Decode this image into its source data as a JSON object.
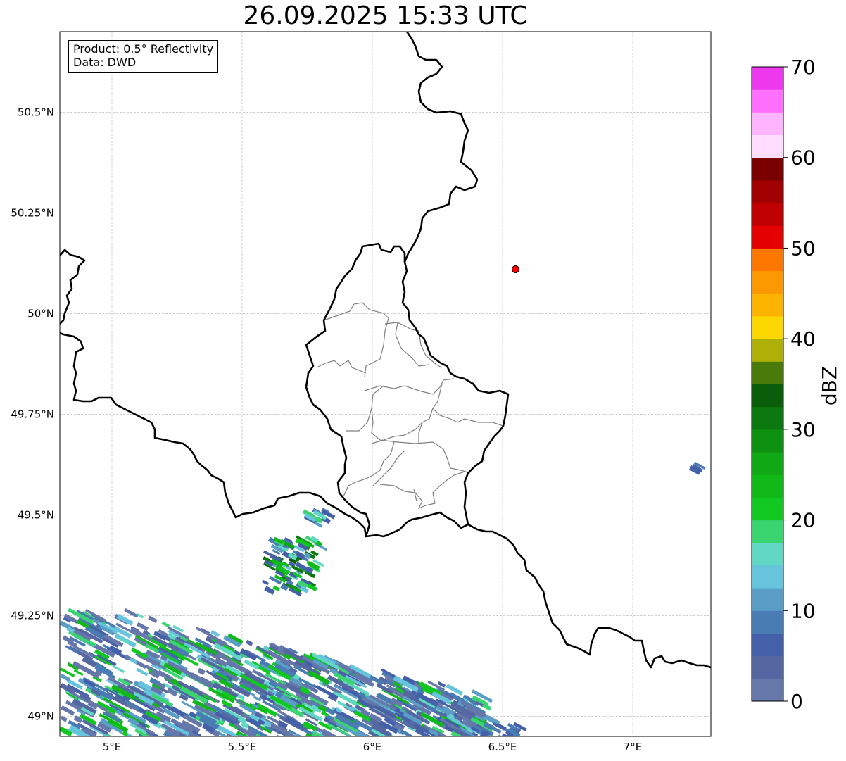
{
  "title": "26.09.2025 15:33 UTC",
  "info": {
    "product": "Product: 0.5° Reflectivity",
    "data": "Data: DWD"
  },
  "map": {
    "extent": {
      "lon_min": 4.8,
      "lon_max": 7.3,
      "lat_min": 48.95,
      "lat_max": 50.7
    },
    "lon_ticks": [
      {
        "value": 5.0,
        "label": "5°E"
      },
      {
        "value": 5.5,
        "label": "5.5°E"
      },
      {
        "value": 6.0,
        "label": "6°E"
      },
      {
        "value": 6.5,
        "label": "6.5°E"
      },
      {
        "value": 7.0,
        "label": "7°E"
      }
    ],
    "lat_ticks": [
      {
        "value": 50.5,
        "label": "50.5°N"
      },
      {
        "value": 50.25,
        "label": "50.25°N"
      },
      {
        "value": 50.0,
        "label": "50°N"
      },
      {
        "value": 49.75,
        "label": "49.75°N"
      },
      {
        "value": 49.5,
        "label": "49.5°N"
      },
      {
        "value": 49.25,
        "label": "49.25°N"
      },
      {
        "value": 49.0,
        "label": "49°N"
      }
    ],
    "radar_site": {
      "lon": 6.55,
      "lat": 50.11,
      "color": "#ff0000"
    },
    "colors": {
      "border": "#000000",
      "admin": "#808080",
      "grid": "#b0b0b0"
    }
  },
  "colorbar": {
    "label": "dBZ",
    "min": 0,
    "max": 70,
    "ticks": [
      "0",
      "10",
      "20",
      "30",
      "40",
      "50",
      "60",
      "70"
    ],
    "colors": [
      "#6677aa",
      "#5566a0",
      "#4460a8",
      "#4a7cb4",
      "#5a9ec8",
      "#66c4dc",
      "#60d8c4",
      "#3ad470",
      "#10c820",
      "#10b818",
      "#10a814",
      "#0e9010",
      "#0c7810",
      "#0a5e0a",
      "#4a7a0a",
      "#aeb008",
      "#fcd800",
      "#fcb400",
      "#fc9800",
      "#fc7800",
      "#e40000",
      "#c00000",
      "#a00000",
      "#7a0000",
      "#ffddff",
      "#ffb4ff",
      "#ff70ff",
      "#ee38ee"
    ]
  },
  "chart_data": {
    "type": "heatmap",
    "title": "26.09.2025 15:33 UTC",
    "xlabel": "",
    "ylabel": "",
    "xlim": [
      4.8,
      7.3
    ],
    "ylim": [
      48.95,
      50.7
    ],
    "colorbar_label": "dBZ",
    "colorbar_range": [
      0,
      70
    ],
    "echo_regions": [
      {
        "lon": [
          4.8,
          6.4
        ],
        "lat": [
          48.95,
          49.27
        ],
        "dbz": [
          0,
          25
        ]
      },
      {
        "lon": [
          5.58,
          5.78
        ],
        "lat": [
          49.32,
          49.45
        ],
        "dbz": [
          5,
          33
        ]
      },
      {
        "lon": [
          5.72,
          5.82
        ],
        "lat": [
          49.48,
          49.52
        ],
        "dbz": [
          5,
          22
        ]
      },
      {
        "lon": [
          6.38,
          6.55
        ],
        "lat": [
          48.95,
          48.99
        ],
        "dbz": [
          5,
          10
        ]
      },
      {
        "lon": [
          7.22,
          7.24
        ],
        "lat": [
          49.62,
          49.64
        ],
        "dbz": [
          5,
          10
        ]
      }
    ]
  }
}
